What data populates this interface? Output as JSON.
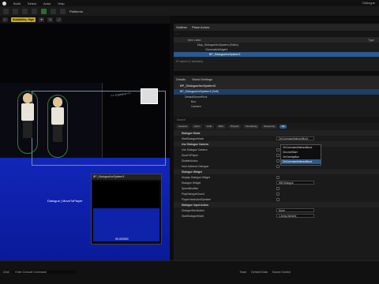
{
  "menu": {
    "items": [
      "Build",
      "Select",
      "Actor",
      "Help"
    ],
    "window_title": "Dialogue"
  },
  "toolbar": {
    "platforms_label": "Platforms"
  },
  "viewport": {
    "chips": [
      "Scalability: High"
    ],
    "camera_label": ">> Camera <<",
    "actor_label": "Dialogue",
    "actor_label2": "MoveToPlayer",
    "preview_title": "BP_DialogueArcSystem3",
    "preview_value": "90.000000"
  },
  "outliner": {
    "tab1": "Outliner",
    "tab2": "Place Actors",
    "col_item": "Item Label",
    "col_type": "Type",
    "rows": [
      "Map_DialogueArcSystem (Editor)",
      "CinematicWidget1",
      "BP_DialogueArcSystem3"
    ],
    "count": "57 actors (1 selected)"
  },
  "details": {
    "tab1": "Details",
    "tab2": "World Settings",
    "bp_name": "BP_DialogueArcSystem3",
    "bp_self": "BP_DialogueArcSystem3 (Self)",
    "components": [
      "DefaultSceneRoot",
      "Box",
      "Camera"
    ],
    "search_placeholder": "Search",
    "filter_tabs": [
      "General",
      "Actor",
      "LOD",
      "Misc",
      "Physics",
      "Rendering",
      "Streaming",
      "All"
    ],
    "properties": [
      {
        "label": "Dialogue Mode",
        "cat": true
      },
      {
        "label": "StartDialogueMode",
        "dd": "OnCommandInteractMove"
      },
      {
        "label": "Use Dialogue Camera",
        "cat": true
      },
      {
        "label": "Use Dialogue Camera",
        "chk": true
      },
      {
        "label": "MoveToPlayer",
        "chk": true
      },
      {
        "label": "DisableActors",
        "chk": true
      },
      {
        "label": "Auto Advance Dialogue",
        "chk": true
      },
      {
        "label": "Dialogue Widget",
        "cat": true
      },
      {
        "label": "Display Dialogue Widget",
        "chk": true
      },
      {
        "label": "Dialogue Widget",
        "dd": "WB Dialogue"
      },
      {
        "label": "SpeedModifier",
        "chk": true
      },
      {
        "label": "PlayDialogueSound",
        "chk": true
      },
      {
        "label": "PlayerHeadsAndSpeaker",
        "chk": true
      },
      {
        "label": "Dialogue Input Action",
        "cat": true
      },
      {
        "label": "DialogueNextAction",
        "dd": "None"
      },
      {
        "label": "StartDialogueMode",
        "dd": "1 Array element"
      }
    ],
    "dropdown_options": [
      "OnCommandInteractMove",
      "OnLevelStart",
      "OnOverlapBox",
      "OnCommandInteractMove"
    ]
  },
  "statusbar": {
    "cmd": "Cmd",
    "console_placeholder": "Enter Console Command",
    "trace": "Trace",
    "derived": "Derived Data",
    "source": "Source Control"
  }
}
